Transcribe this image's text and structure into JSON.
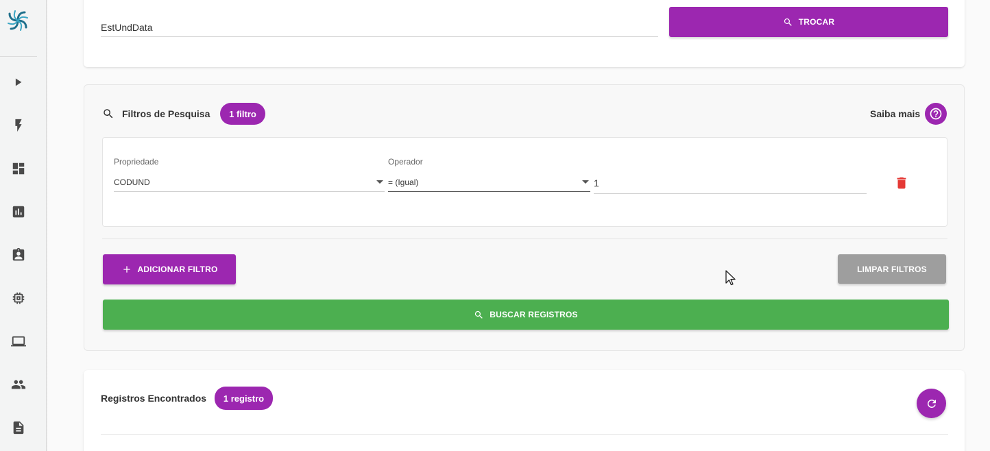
{
  "sidebar": {
    "logo": "app-logo",
    "items": [
      {
        "icon": "play-icon"
      },
      {
        "icon": "lightning-icon"
      },
      {
        "icon": "dashboard-icon"
      },
      {
        "icon": "chart-icon"
      },
      {
        "icon": "clipboard-user-icon"
      },
      {
        "icon": "chip-icon"
      },
      {
        "icon": "laptop-icon"
      },
      {
        "icon": "people-icon"
      },
      {
        "icon": "document-icon"
      }
    ]
  },
  "table_selector": {
    "value": "EstUndData",
    "button_label": "TROCAR"
  },
  "filters": {
    "title": "Filtros de Pesquisa",
    "count_badge": "1 filtro",
    "help_label": "Saiba mais",
    "row": {
      "property_label": "Propriedade",
      "property_value": "CODUND",
      "operator_label": "Operador",
      "operator_value": "= (Igual)",
      "value": "1"
    },
    "add_button": "ADICIONAR FILTRO",
    "clear_button": "LIMPAR FILTROS",
    "search_button": "BUSCAR REGISTROS"
  },
  "results": {
    "title": "Registros Encontrados",
    "count_badge": "1 registro"
  },
  "colors": {
    "accent": "#9c27b0",
    "success": "#4caf50",
    "neutral_button": "#9e9e9e",
    "danger": "#e53935"
  }
}
